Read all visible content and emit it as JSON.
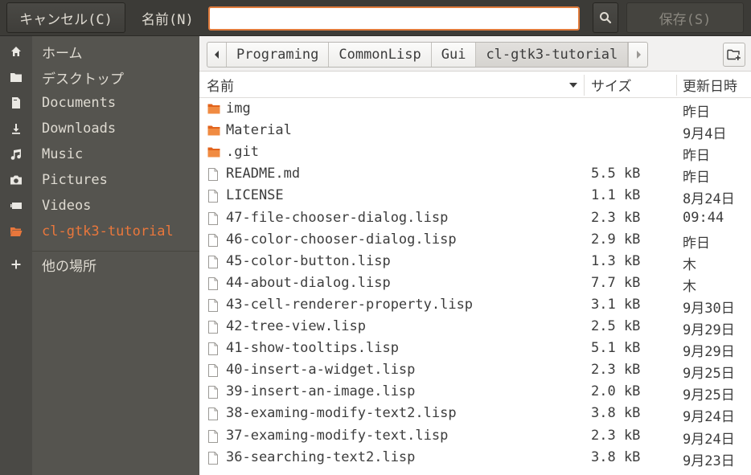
{
  "header": {
    "cancel_label": "キャンセル(C)",
    "name_label": "名前(N)",
    "name_value": "",
    "save_label": "保存(S)"
  },
  "sidebar": {
    "items": [
      {
        "label": "ホーム",
        "icon": "home-icon"
      },
      {
        "label": "デスクトップ",
        "icon": "folder-icon"
      },
      {
        "label": "Documents",
        "icon": "document-icon"
      },
      {
        "label": "Downloads",
        "icon": "download-icon"
      },
      {
        "label": "Music",
        "icon": "music-icon"
      },
      {
        "label": "Pictures",
        "icon": "camera-icon"
      },
      {
        "label": "Videos",
        "icon": "video-icon"
      },
      {
        "label": "cl-gtk3-tutorial",
        "icon": "folder-icon",
        "active": true
      }
    ],
    "other_locations": "他の場所"
  },
  "pathbar": {
    "crumbs": [
      "Programing",
      "CommonLisp",
      "Gui",
      "cl-gtk3-tutorial"
    ]
  },
  "columns": {
    "name": "名前",
    "size": "サイズ",
    "modified": "更新日時"
  },
  "files": [
    {
      "name": "img",
      "size": "",
      "modified": "昨日",
      "type": "folder"
    },
    {
      "name": "Material",
      "size": "",
      "modified": "9月4日",
      "type": "folder"
    },
    {
      "name": ".git",
      "size": "",
      "modified": "昨日",
      "type": "folder"
    },
    {
      "name": "README.md",
      "size": "5.5 kB",
      "modified": "昨日",
      "type": "file"
    },
    {
      "name": "LICENSE",
      "size": "1.1 kB",
      "modified": "8月24日",
      "type": "file"
    },
    {
      "name": "47-file-chooser-dialog.lisp",
      "size": "2.3 kB",
      "modified": "09:44",
      "type": "file"
    },
    {
      "name": "46-color-chooser-dialog.lisp",
      "size": "2.9 kB",
      "modified": "昨日",
      "type": "file"
    },
    {
      "name": "45-color-button.lisp",
      "size": "1.3 kB",
      "modified": "木",
      "type": "file"
    },
    {
      "name": "44-about-dialog.lisp",
      "size": "7.7 kB",
      "modified": "木",
      "type": "file"
    },
    {
      "name": "43-cell-renderer-property.lisp",
      "size": "3.1 kB",
      "modified": "9月30日",
      "type": "file"
    },
    {
      "name": "42-tree-view.lisp",
      "size": "2.5 kB",
      "modified": "9月29日",
      "type": "file"
    },
    {
      "name": "41-show-tooltips.lisp",
      "size": "5.1 kB",
      "modified": "9月29日",
      "type": "file"
    },
    {
      "name": "40-insert-a-widget.lisp",
      "size": "2.3 kB",
      "modified": "9月25日",
      "type": "file"
    },
    {
      "name": "39-insert-an-image.lisp",
      "size": "2.0 kB",
      "modified": "9月25日",
      "type": "file"
    },
    {
      "name": "38-examing-modify-text2.lisp",
      "size": "3.8 kB",
      "modified": "9月24日",
      "type": "file"
    },
    {
      "name": "37-examing-modify-text.lisp",
      "size": "2.3 kB",
      "modified": "9月24日",
      "type": "file"
    },
    {
      "name": "36-searching-text2.lisp",
      "size": "3.8 kB",
      "modified": "9月23日",
      "type": "file"
    }
  ],
  "colors": {
    "accent": "#e9773c",
    "sidebar_bg": "#55544f",
    "header_bg": "#3c3b37"
  }
}
